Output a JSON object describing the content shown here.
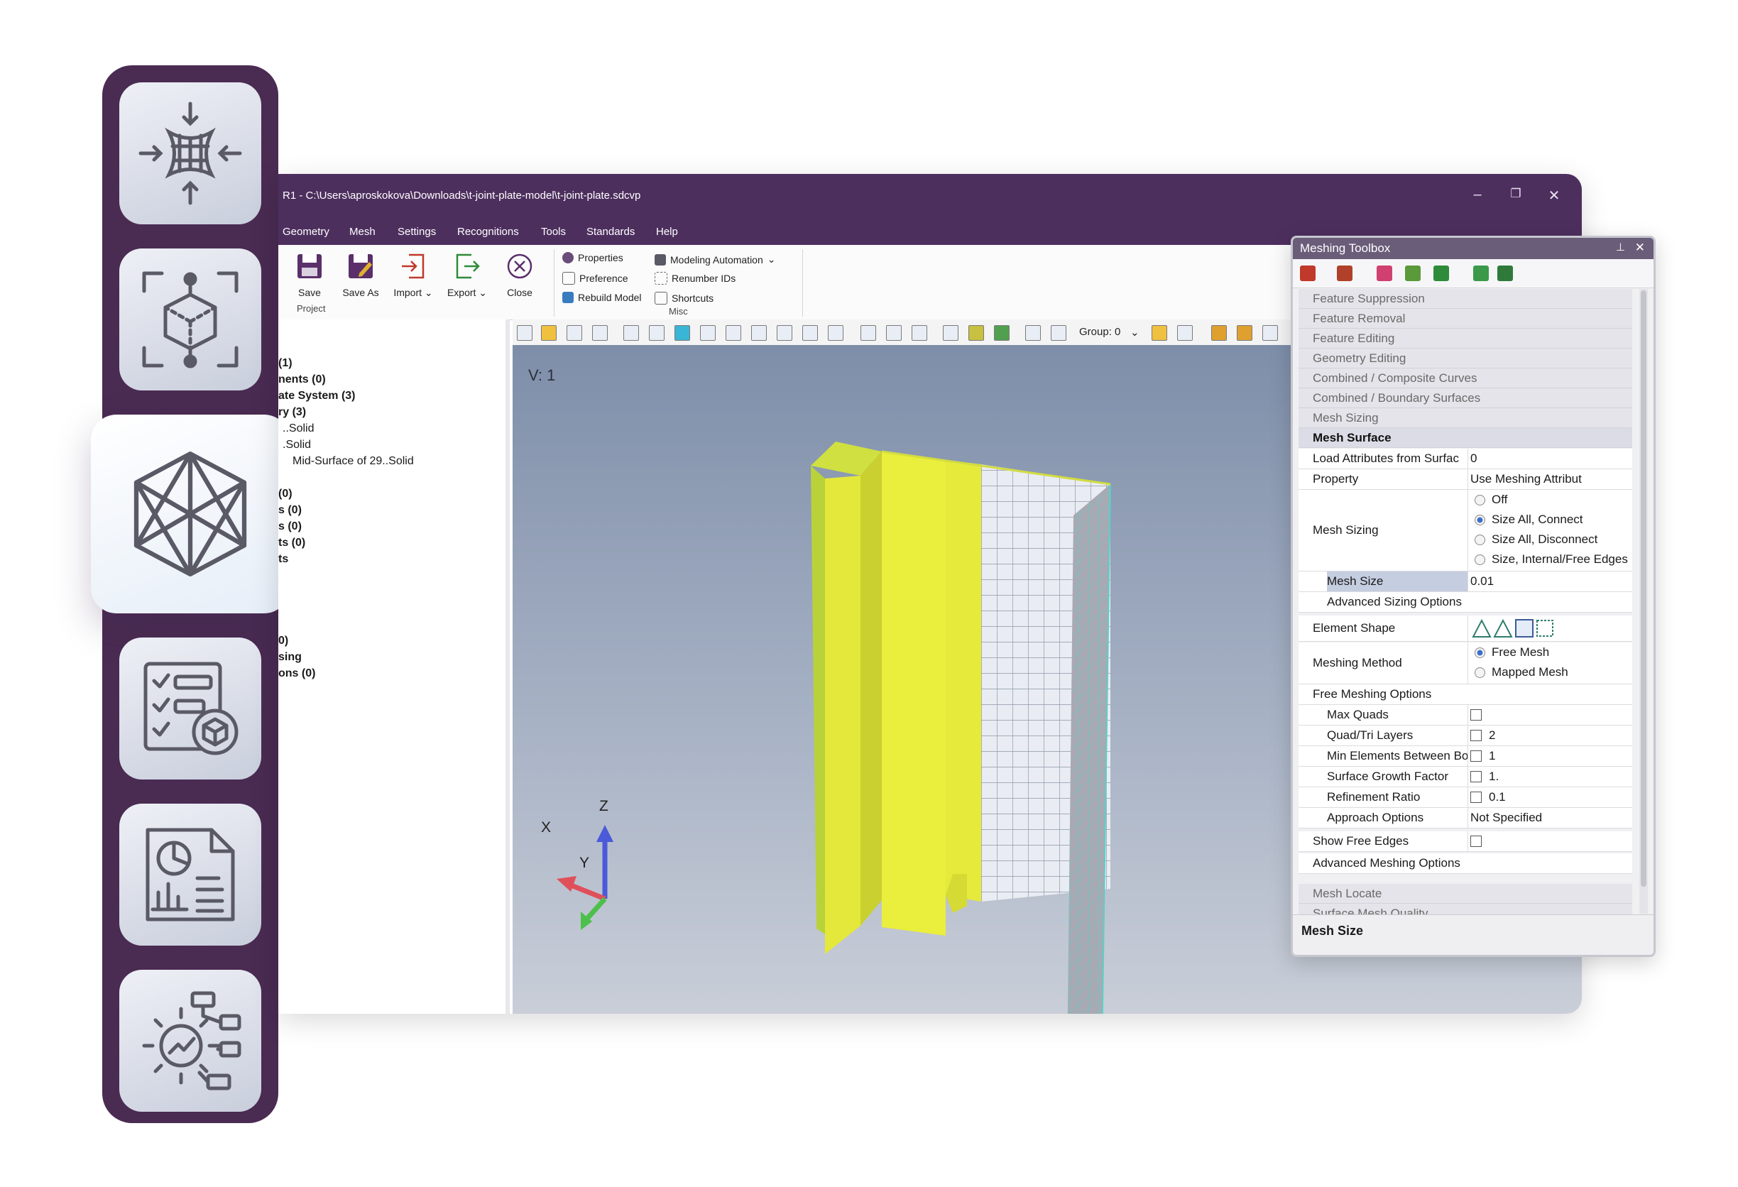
{
  "app": {
    "title": "R1 - C:\\Users\\aproskokova\\Downloads\\t-joint-plate-model\\t-joint-plate.sdcvp",
    "minimize": "–",
    "restore": "❐",
    "close": "✕",
    "accent": "#4d2f5e"
  },
  "menu": [
    "Geometry",
    "Mesh",
    "Settings",
    "Recognitions",
    "Tools",
    "Standards",
    "Help"
  ],
  "ribbon": {
    "save": "Save",
    "save_as": "Save As",
    "import": "Import",
    "export": "Export",
    "close": "Close",
    "project_group": "Project",
    "properties": "Properties",
    "preference": "Preference",
    "rebuild_model": "Rebuild Model",
    "modeling_automation": "Modeling Automation",
    "renumber_ids": "Renumber IDs",
    "shortcuts": "Shortcuts",
    "misc_group": "Misc"
  },
  "tree": [
    {
      "text": "(1)",
      "bold": true
    },
    {
      "text": "nents (0)",
      "bold": true
    },
    {
      "text": "ate System (3)",
      "bold": true
    },
    {
      "text": "ry (3)",
      "bold": true
    },
    {
      "text": "..Solid",
      "bold": false
    },
    {
      "text": ".Solid",
      "bold": false
    },
    {
      "text": "Mid-Surface of 29..Solid",
      "bold": false
    },
    {
      "text": "",
      "bold": false
    },
    {
      "text": "(0)",
      "bold": true
    },
    {
      "text": "s (0)",
      "bold": true
    },
    {
      "text": "s (0)",
      "bold": true
    },
    {
      "text": "ts (0)",
      "bold": true
    },
    {
      "text": "ts",
      "bold": true
    },
    {
      "text": "",
      "bold": false
    },
    {
      "text": "",
      "bold": false
    },
    {
      "text": "",
      "bold": false
    },
    {
      "text": "0)",
      "bold": true
    },
    {
      "text": "sing",
      "bold": true
    },
    {
      "text": "ons (0)",
      "bold": true
    }
  ],
  "viewport": {
    "group_label": "Group: 0",
    "view_label": "V: 1",
    "axes": {
      "x": "X",
      "y": "Y",
      "z": "Z"
    }
  },
  "toolbox": {
    "title": "Meshing Toolbox",
    "pin": "📌",
    "close": "✕",
    "sections_top": [
      "Feature Suppression",
      "Feature Removal",
      "Feature Editing",
      "Geometry Editing",
      "Combined / Composite Curves",
      "Combined / Boundary Surfaces",
      "Mesh Sizing"
    ],
    "current_section": "Mesh Surface",
    "props": {
      "load_attr_label": "Load Attributes from Surfac",
      "load_attr_value": "0",
      "property_label": "Property",
      "property_value": "Use Meshing Attribut",
      "mesh_sizing_label": "Mesh Sizing",
      "mesh_sizing_options": [
        "Off",
        "Size All, Connect",
        "Size All, Disconnect",
        "Size, Internal/Free Edges"
      ],
      "mesh_sizing_selected": "Size All, Connect",
      "mesh_size_label": "Mesh Size",
      "mesh_size_value": "0.01",
      "adv_sizing_label": "Advanced Sizing Options",
      "element_shape_label": "Element Shape",
      "meshing_method_label": "Meshing Method",
      "meshing_method_options": [
        "Free Mesh",
        "Mapped Mesh"
      ],
      "meshing_method_selected": "Free Mesh",
      "free_meshing_label": "Free Meshing Options",
      "max_quads_label": "Max Quads",
      "quad_tri_label": "Quad/Tri Layers",
      "quad_tri_value": "2",
      "min_elem_label": "Min Elements Between Bo",
      "min_elem_value": "1",
      "growth_label": "Surface Growth Factor",
      "growth_value": "1.",
      "refine_label": "Refinement Ratio",
      "refine_value": "0.1",
      "approach_label": "Approach Options",
      "approach_value": "Not Specified",
      "show_free_edges_label": "Show Free Edges",
      "adv_meshing_label": "Advanced Meshing Options"
    },
    "sections_bottom": [
      "Mesh Locate",
      "Surface Mesh Quality"
    ],
    "footer": "Mesh Size"
  },
  "colors": {
    "rail": "#4a2b52",
    "titlebar": "#4d2f5e",
    "model_yellow": "#e8ea3a",
    "mesh_line": "#4fd0c4"
  },
  "icons": {
    "rail": [
      "compression-icon",
      "cube-frame-icon",
      "mesh-cube-icon",
      "checklist-icon",
      "report-icon",
      "gear-analytics-icon"
    ]
  }
}
